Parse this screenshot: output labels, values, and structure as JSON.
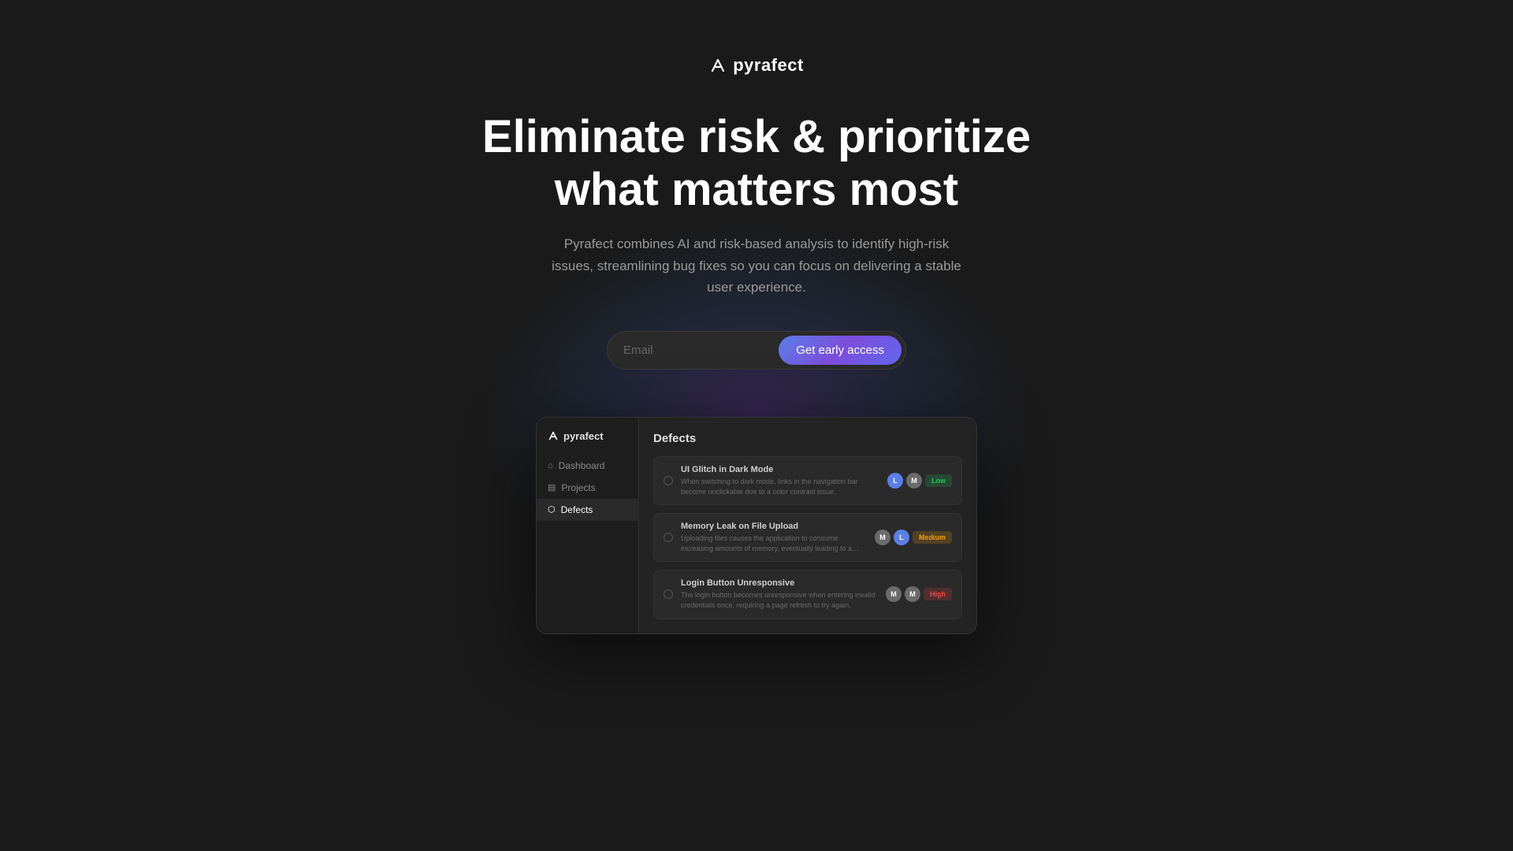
{
  "logo": {
    "text": "pyrafect"
  },
  "hero": {
    "heading_line1": "Eliminate risk & prioritize",
    "heading_line2": "what matters most",
    "subtext": "Pyrafect combines AI and risk-based analysis to identify high-risk issues, streamlining bug fixes so you can focus on delivering a stable user experience."
  },
  "form": {
    "email_placeholder": "Email",
    "cta_label": "Get early access"
  },
  "preview": {
    "sidebar": {
      "logo": "pyrafect",
      "nav_items": [
        {
          "label": "Dashboard",
          "icon": "⌂",
          "active": false
        },
        {
          "label": "Projects",
          "icon": "▤",
          "active": false
        },
        {
          "label": "Defects",
          "icon": "⬡",
          "active": true
        }
      ]
    },
    "main": {
      "title": "Defects",
      "defects": [
        {
          "name": "UI Glitch in Dark Mode",
          "desc": "When switching to dark mode, links in the navigation bar become unclickable due to a color contrast issue.",
          "badges": [
            "L",
            "M"
          ],
          "severity": "Low",
          "severity_class": "severity-low"
        },
        {
          "name": "Memory Leak on File Upload",
          "desc": "Uploading files causes the application to consume increasing amounts of memory, eventually leading to a crash.",
          "badges": [
            "M",
            "L"
          ],
          "severity": "Medium",
          "severity_class": "severity-medium"
        },
        {
          "name": "Login Button Unresponsive",
          "desc": "The login button becomes unresponsive when entering invalid credentials once, requiring a page refresh to try again.",
          "badges": [
            "M",
            "M"
          ],
          "severity": "High",
          "severity_class": "severity-high"
        }
      ]
    }
  }
}
